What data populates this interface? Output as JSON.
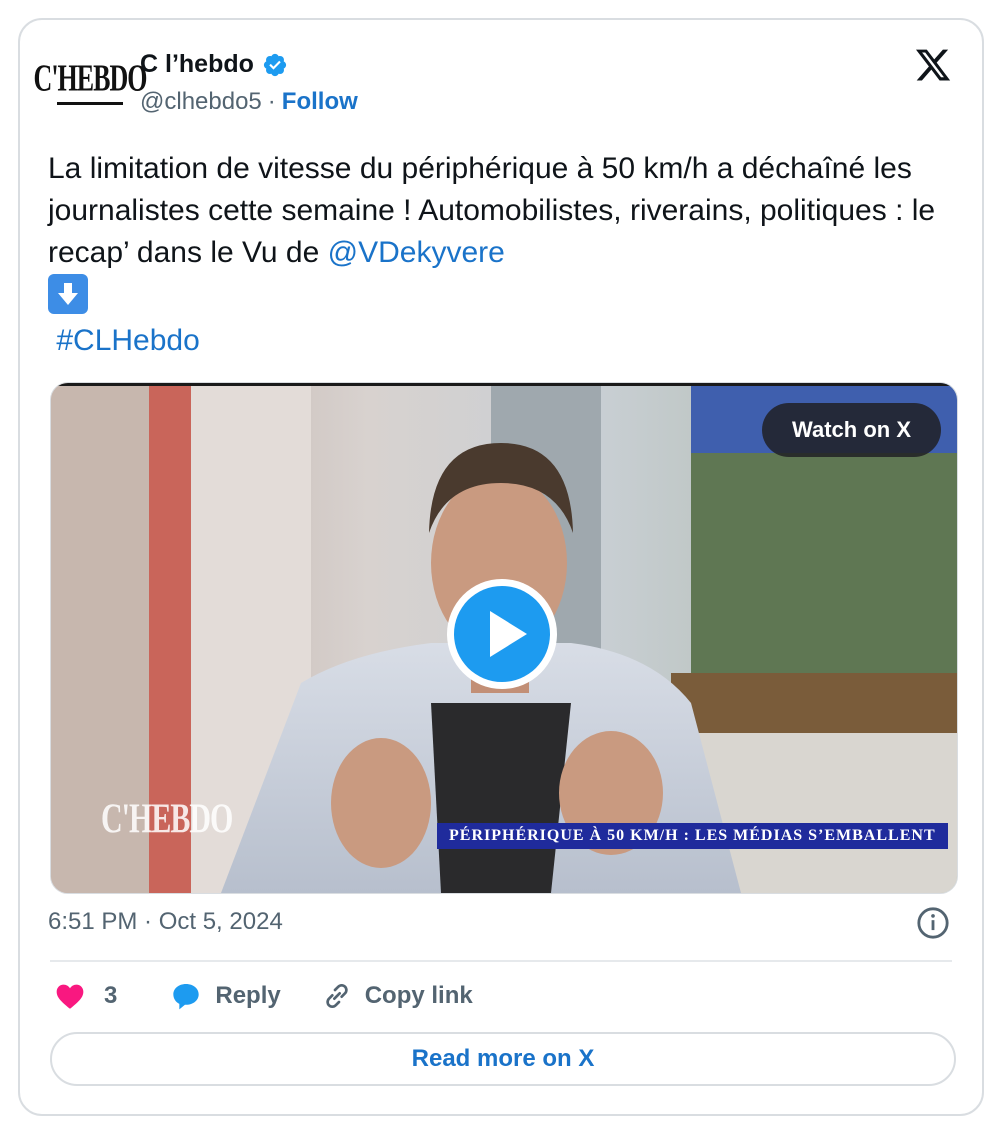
{
  "author": {
    "avatar_text": "C'HEBDO",
    "name": "C l’hebdo",
    "handle": "@clhebdo5",
    "separator": "·",
    "follow_label": "Follow"
  },
  "tweet": {
    "text_main": "La limitation de vitesse du périphérique à 50 km/h a déchaîné les journalistes cette semaine ! Automobilistes, riverains, politiques : le recap’ dans le Vu de ",
    "mention": "@VDekyvere",
    "hashtag": "#CLHebdo"
  },
  "media": {
    "watch_label": "Watch on X",
    "banner_text": "PÉRIPHÉRIQUE À 50 KM/H : LES MÉDIAS S’EMBALLENT",
    "watermark_text": "C'HEBDO"
  },
  "timestamp": "6:51 PM · Oct 5, 2024",
  "actions": {
    "like_count": "3",
    "reply_label": "Reply",
    "copy_label": "Copy link"
  },
  "read_more_label": "Read more on X",
  "colors": {
    "accent": "#1a73c9",
    "like": "#f91880",
    "verified": "#1d9bf0",
    "muted": "#536471"
  }
}
